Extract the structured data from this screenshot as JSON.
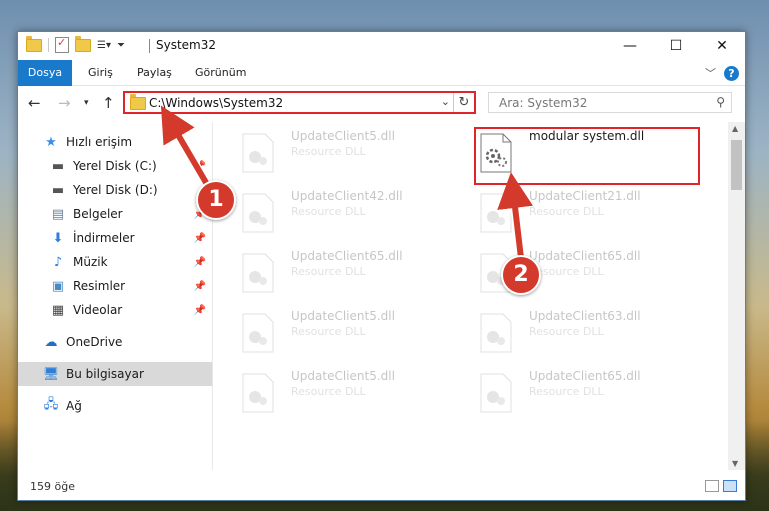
{
  "window": {
    "title": "System32"
  },
  "ribbon": {
    "tabs": [
      "Dosya",
      "Giriş",
      "Paylaş",
      "Görünüm"
    ]
  },
  "address": {
    "path": "C:\\Windows\\System32"
  },
  "search": {
    "placeholder": "Ara: System32"
  },
  "sidebar": {
    "items": [
      {
        "label": "Hızlı erişim",
        "icon": "star-icon"
      },
      {
        "label": "Yerel Disk (C:)",
        "icon": "drive-icon"
      },
      {
        "label": "Yerel Disk (D:)",
        "icon": "drive-icon"
      },
      {
        "label": "Belgeler",
        "icon": "documents-icon"
      },
      {
        "label": "İndirmeler",
        "icon": "download-icon"
      },
      {
        "label": "Müzik",
        "icon": "music-icon"
      },
      {
        "label": "Resimler",
        "icon": "pictures-icon"
      },
      {
        "label": "Videolar",
        "icon": "videos-icon"
      },
      {
        "label": "OneDrive",
        "icon": "cloud-icon"
      },
      {
        "label": "Bu bilgisayar",
        "icon": "computer-icon"
      },
      {
        "label": "Ağ",
        "icon": "network-icon"
      }
    ]
  },
  "files": {
    "col1": [
      {
        "name": "UpdateClient5.dll",
        "type": "Resource DLL"
      },
      {
        "name": "UpdateClient42.dll",
        "type": "Resource DLL"
      },
      {
        "name": "UpdateClient65.dll",
        "type": "Resource DLL"
      },
      {
        "name": "UpdateClient5.dll",
        "type": "Resource DLL"
      },
      {
        "name": "UpdateClient5.dll",
        "type": "Resource DLL"
      }
    ],
    "col2": [
      {
        "name": "modular system.dll",
        "type": ""
      },
      {
        "name": "UpdateClient21.dll",
        "type": "Resource DLL"
      },
      {
        "name": "UpdateClient65.dll",
        "type": "Resource DLL"
      },
      {
        "name": "UpdateClient63.dll",
        "type": "Resource DLL"
      },
      {
        "name": "UpdateClient65.dll",
        "type": "Resource DLL"
      }
    ]
  },
  "status": {
    "count": "159 öğe"
  },
  "annotations": {
    "step1": "1",
    "step2": "2"
  },
  "colors": {
    "accent": "#1979ca",
    "highlight": "#e0242a",
    "callout": "#d33a2c"
  }
}
